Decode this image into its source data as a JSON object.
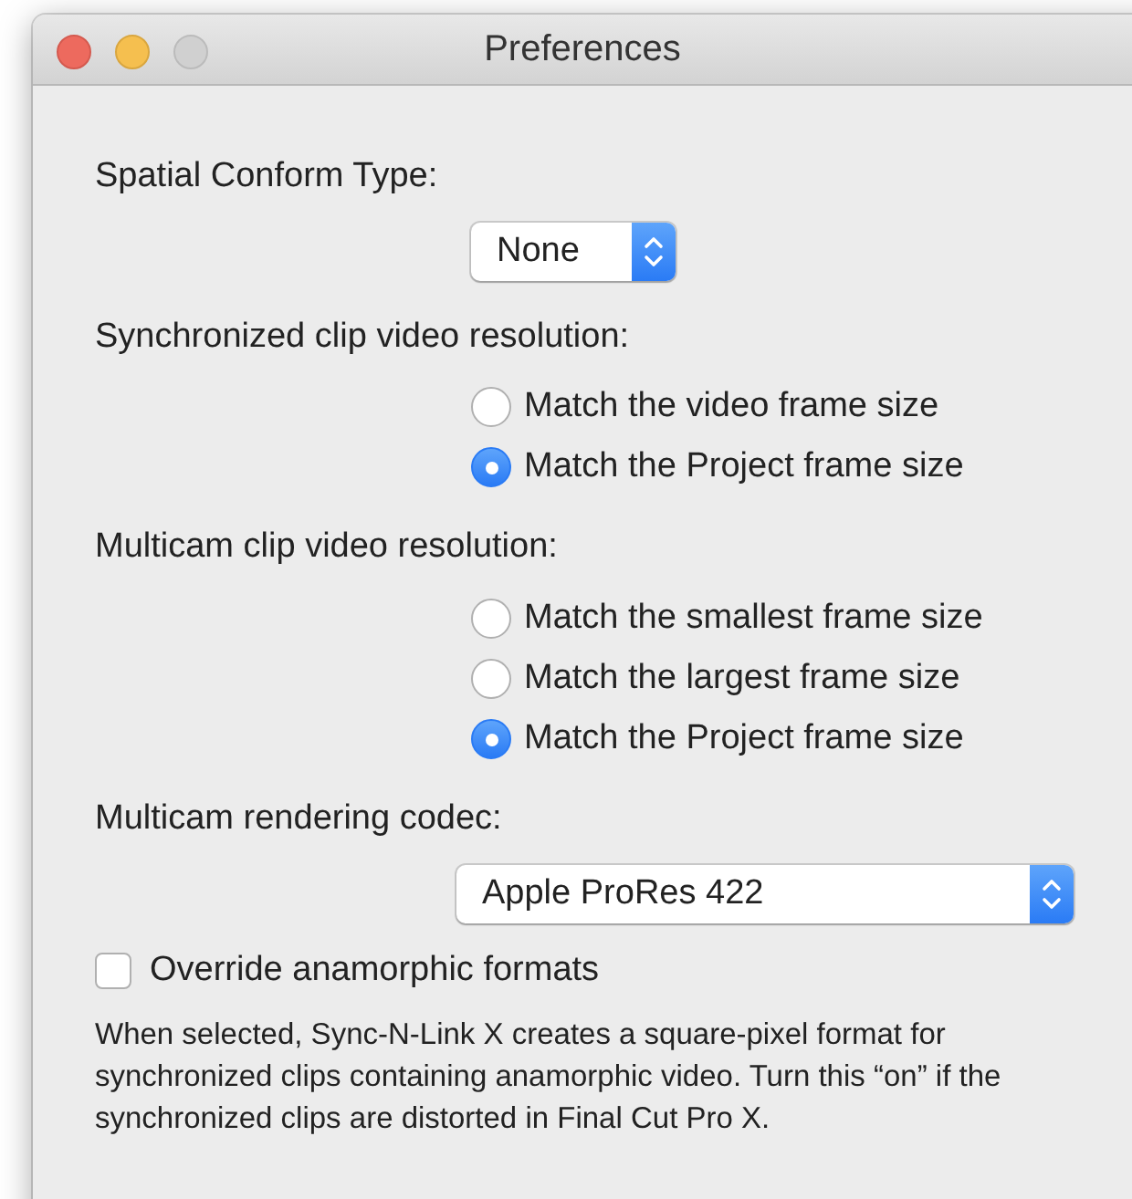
{
  "window": {
    "title": "Preferences"
  },
  "spatial_conform": {
    "label": "Spatial Conform Type:",
    "popup": {
      "value": "None"
    }
  },
  "sync_resolution": {
    "label": "Synchronized clip video resolution:",
    "options": [
      {
        "label": "Match the video frame size",
        "selected": false
      },
      {
        "label": "Match the Project frame size",
        "selected": true
      }
    ]
  },
  "multicam_resolution": {
    "label": "Multicam clip video resolution:",
    "options": [
      {
        "label": "Match the smallest frame size",
        "selected": false
      },
      {
        "label": "Match the largest frame size",
        "selected": false
      },
      {
        "label": "Match the Project frame size",
        "selected": true
      }
    ]
  },
  "rendering_codec": {
    "label": "Multicam rendering codec:",
    "popup": {
      "value": "Apple ProRes 422"
    }
  },
  "override_anamorphic": {
    "label": "Override anamorphic formats",
    "checked": false
  },
  "description": "When selected, Sync-N-Link X creates a square-pixel format for synchronized clips containing anamorphic video. Turn this “on” if the synchronized clips are distorted in Final Cut Pro X."
}
